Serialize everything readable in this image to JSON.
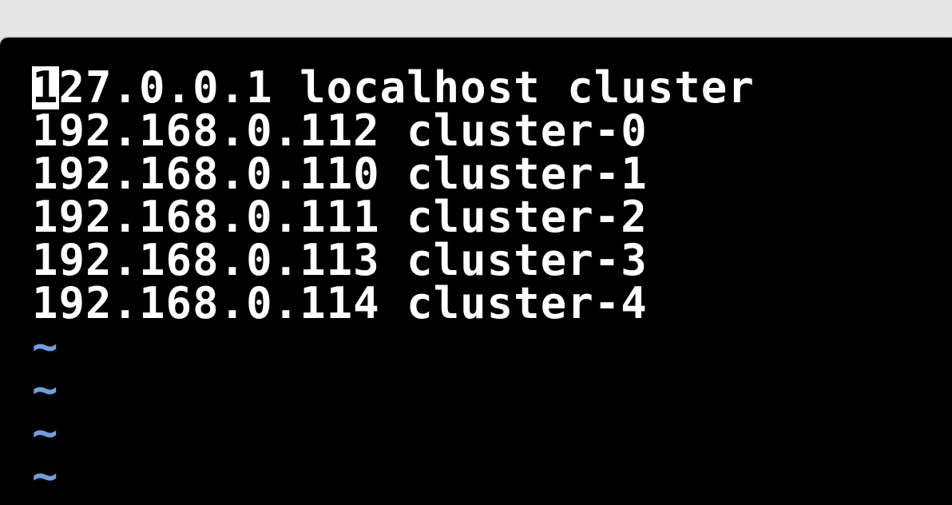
{
  "editor": {
    "cursor_char": "1",
    "first_line_rest": "27.0.0.1 localhost cluster",
    "lines": [
      "192.168.0.112 cluster-0",
      "192.168.0.110 cluster-1",
      "192.168.0.111 cluster-2",
      "192.168.0.113 cluster-3",
      "192.168.0.114 cluster-4"
    ],
    "empty_line_marker": "~",
    "tilde_color": "#6f9fe0"
  }
}
